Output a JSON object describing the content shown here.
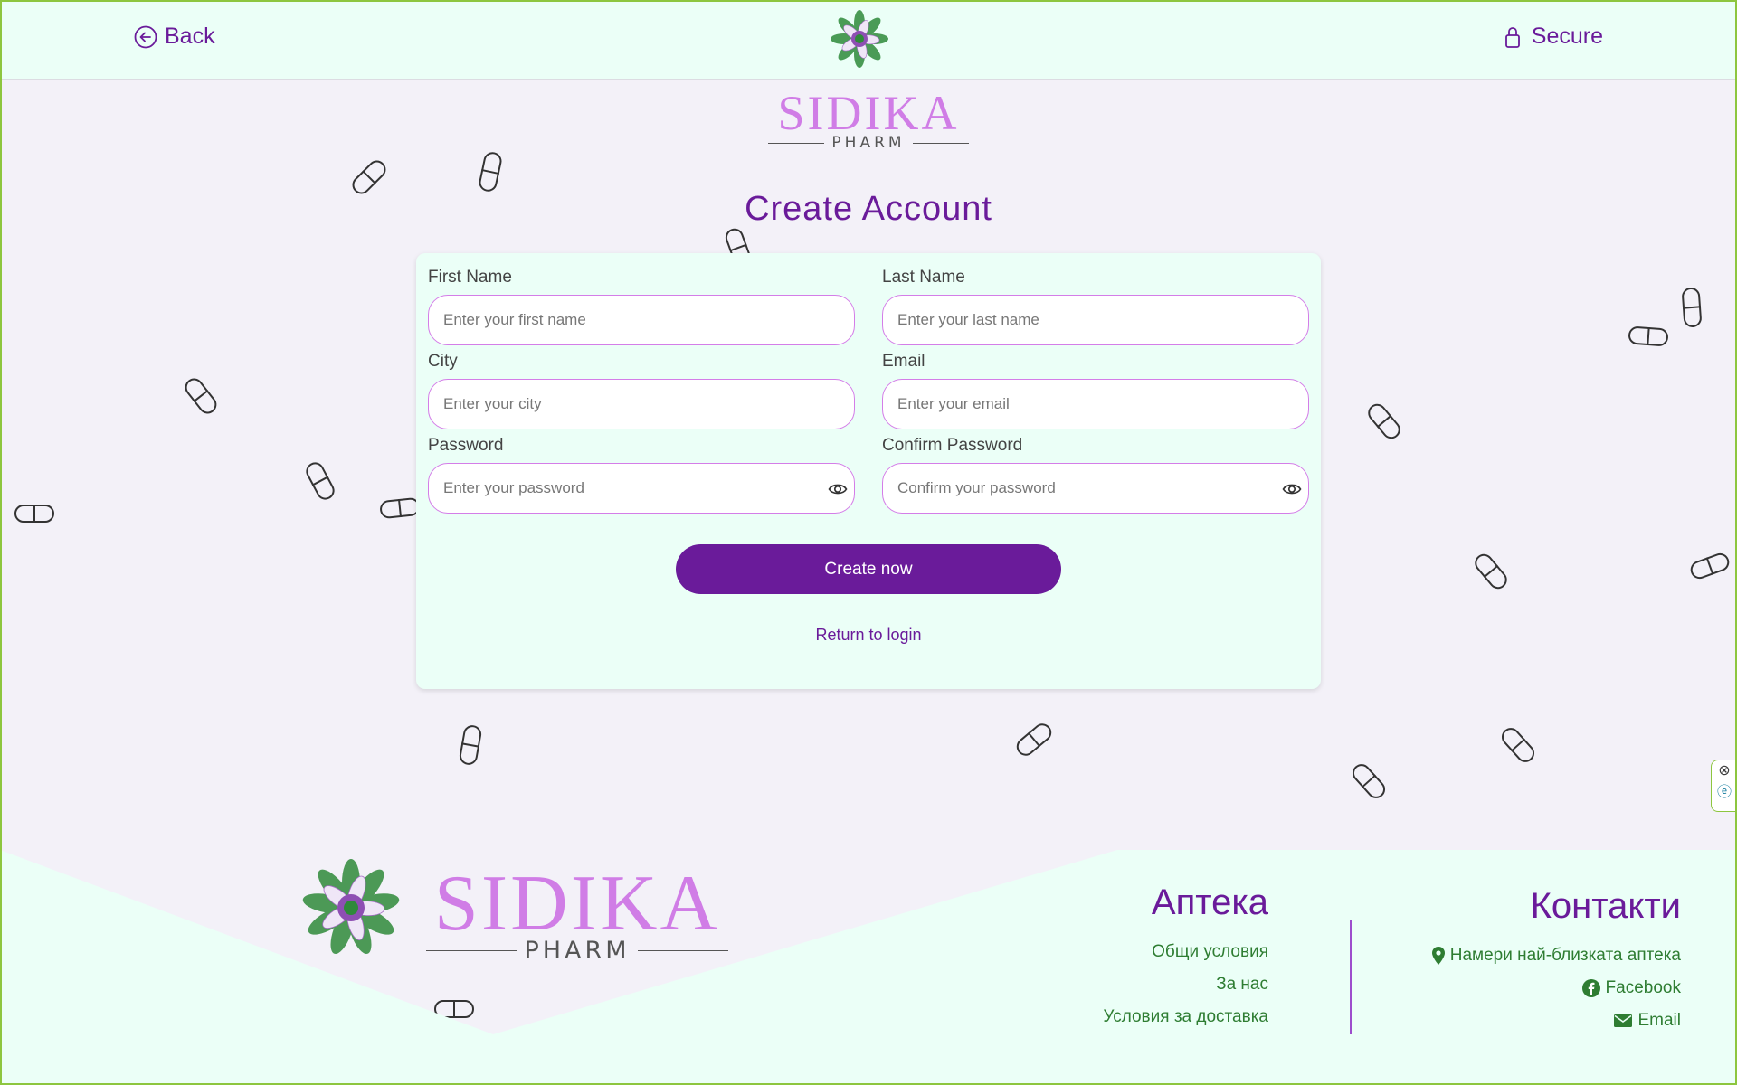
{
  "header": {
    "back_label": "Back",
    "secure_label": "Secure"
  },
  "brand": {
    "name": "SIDIKA",
    "sub": "PHARM"
  },
  "page_title": "Create Account",
  "form": {
    "first_name": {
      "label": "First Name",
      "placeholder": "Enter your first name"
    },
    "last_name": {
      "label": "Last Name",
      "placeholder": "Enter your last name"
    },
    "city": {
      "label": "City",
      "placeholder": "Enter your city"
    },
    "email": {
      "label": "Email",
      "placeholder": "Enter your email"
    },
    "password": {
      "label": "Password",
      "placeholder": "Enter your password"
    },
    "confirm_password": {
      "label": "Confirm Password",
      "placeholder": "Confirm your password"
    },
    "submit_label": "Create now",
    "return_label": "Return to login"
  },
  "footer": {
    "pharmacy": {
      "title": "Аптека",
      "links": [
        "Общи условия",
        "За нас",
        "Условия за доставка"
      ]
    },
    "contacts": {
      "title": "Контакти",
      "links": [
        {
          "icon": "location-pin-icon",
          "label": "Намери най-близката аптека"
        },
        {
          "icon": "facebook-icon",
          "label": "Facebook"
        },
        {
          "icon": "envelope-icon",
          "label": "Email"
        }
      ]
    }
  },
  "colors": {
    "accent": "#6a1b9a",
    "logo_pink": "#d07de6",
    "header_bg": "#ebfff7",
    "page_bg": "#f3f1f8",
    "footer_link": "#2e7d32",
    "frame": "#8dc63f"
  }
}
